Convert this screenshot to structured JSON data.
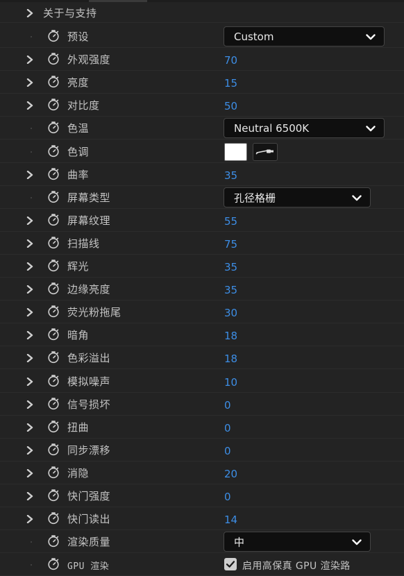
{
  "panel": {
    "section_title": "关于与支持",
    "colors": {
      "background": "#232323",
      "label": "#c4c4c4",
      "value": "#3d8ee6",
      "dropdown_bg": "#0f0f0f"
    },
    "rows": [
      {
        "label": "预设",
        "kind": "dropdown",
        "value": "Custom"
      },
      {
        "label": "外观强度",
        "kind": "number",
        "value": "70"
      },
      {
        "label": "亮度",
        "kind": "number",
        "value": "15"
      },
      {
        "label": "对比度",
        "kind": "number",
        "value": "50"
      },
      {
        "label": "色温",
        "kind": "dropdown",
        "value": "Neutral 6500K"
      },
      {
        "label": "色调",
        "kind": "color",
        "value": "#ffffff"
      },
      {
        "label": "曲率",
        "kind": "number",
        "value": "35"
      },
      {
        "label": "屏幕类型",
        "kind": "dropdown",
        "value": "孔径格栅"
      },
      {
        "label": "屏幕纹理",
        "kind": "number",
        "value": "55"
      },
      {
        "label": "扫描线",
        "kind": "number",
        "value": "75"
      },
      {
        "label": "辉光",
        "kind": "number",
        "value": "35"
      },
      {
        "label": "边缘亮度",
        "kind": "number",
        "value": "35"
      },
      {
        "label": "荧光粉拖尾",
        "kind": "number",
        "value": "30"
      },
      {
        "label": "暗角",
        "kind": "number",
        "value": "18"
      },
      {
        "label": "色彩溢出",
        "kind": "number",
        "value": "18"
      },
      {
        "label": "模拟噪声",
        "kind": "number",
        "value": "10"
      },
      {
        "label": "信号损坏",
        "kind": "number",
        "value": "0"
      },
      {
        "label": "扭曲",
        "kind": "number",
        "value": "0"
      },
      {
        "label": "同步漂移",
        "kind": "number",
        "value": "0"
      },
      {
        "label": "消隐",
        "kind": "number",
        "value": "20"
      },
      {
        "label": "快门强度",
        "kind": "number",
        "value": "0"
      },
      {
        "label": "快门读出",
        "kind": "number",
        "value": "14"
      },
      {
        "label": "渲染质量",
        "kind": "dropdown",
        "value": "中"
      },
      {
        "label": "GPU 渲染",
        "kind": "checkbox",
        "value": "启用高保真 GPU 渲染路",
        "checked": true
      }
    ],
    "icons": {
      "expand": "chevron-right-icon",
      "keyframe": "stopwatch-icon",
      "dropdown": "chevron-down-icon",
      "eyedropper": "eyedropper-icon",
      "checkbox": "checkmark-icon"
    }
  }
}
